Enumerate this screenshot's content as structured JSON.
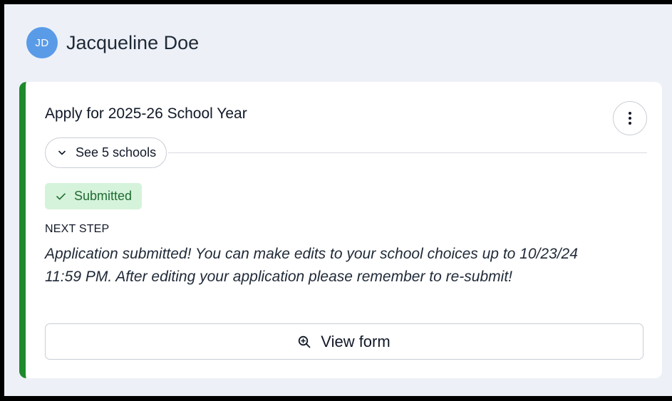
{
  "user": {
    "initials": "JD",
    "name": "Jacqueline Doe",
    "avatar_color": "#5a9be8"
  },
  "card": {
    "title": "Apply for 2025-26 School Year",
    "accent_color": "#1e8a2b",
    "menu_icon": "more-vertical-icon",
    "schools_toggle_label": "See 5 schools",
    "schools_toggle_icon": "chevron-down-icon",
    "status_label": "Submitted",
    "status_icon": "check-icon",
    "status_bg": "#d5f3da",
    "next_step_label": "NEXT STEP",
    "next_step_text": "Application submitted! You can make edits to your school choices up to 10/23/24 11:59 PM. After editing your application please remember to re-submit!",
    "view_form_label": "View form",
    "view_form_icon": "zoom-in-icon"
  }
}
